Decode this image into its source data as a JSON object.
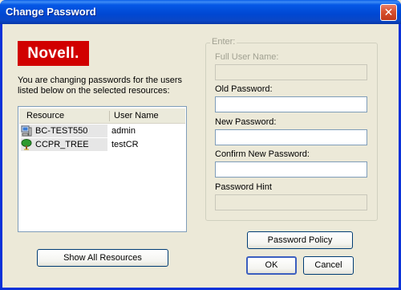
{
  "window": {
    "title": "Change Password",
    "close_glyph": "✕"
  },
  "logo": {
    "text": "Novell.",
    "color": "#d10000"
  },
  "intro_text": "You are changing passwords for the users listed below on the selected resources:",
  "resources": {
    "columns": [
      "Resource",
      "User Name"
    ],
    "rows": [
      {
        "resource": "BC-TEST550",
        "user": "admin",
        "icon": "server-icon"
      },
      {
        "resource": "CCPR_TREE",
        "user": "testCR",
        "icon": "tree-icon"
      }
    ]
  },
  "show_all_button": "Show All Resources",
  "enter_group": {
    "legend": "Enter:",
    "full_user_name": {
      "label": "Full User Name:",
      "value": ""
    },
    "old_password": {
      "label": "Old Password:",
      "value": ""
    },
    "new_password": {
      "label": "New Password:",
      "value": ""
    },
    "confirm_password": {
      "label": "Confirm New Password:",
      "value": ""
    },
    "password_hint": {
      "label": "Password Hint",
      "value": ""
    }
  },
  "buttons": {
    "password_policy": "Password Policy",
    "ok": "OK",
    "cancel": "Cancel"
  },
  "colors": {
    "titlebar": "#0047d2",
    "brand": "#d10000",
    "dialog_bg": "#ece9d8"
  }
}
